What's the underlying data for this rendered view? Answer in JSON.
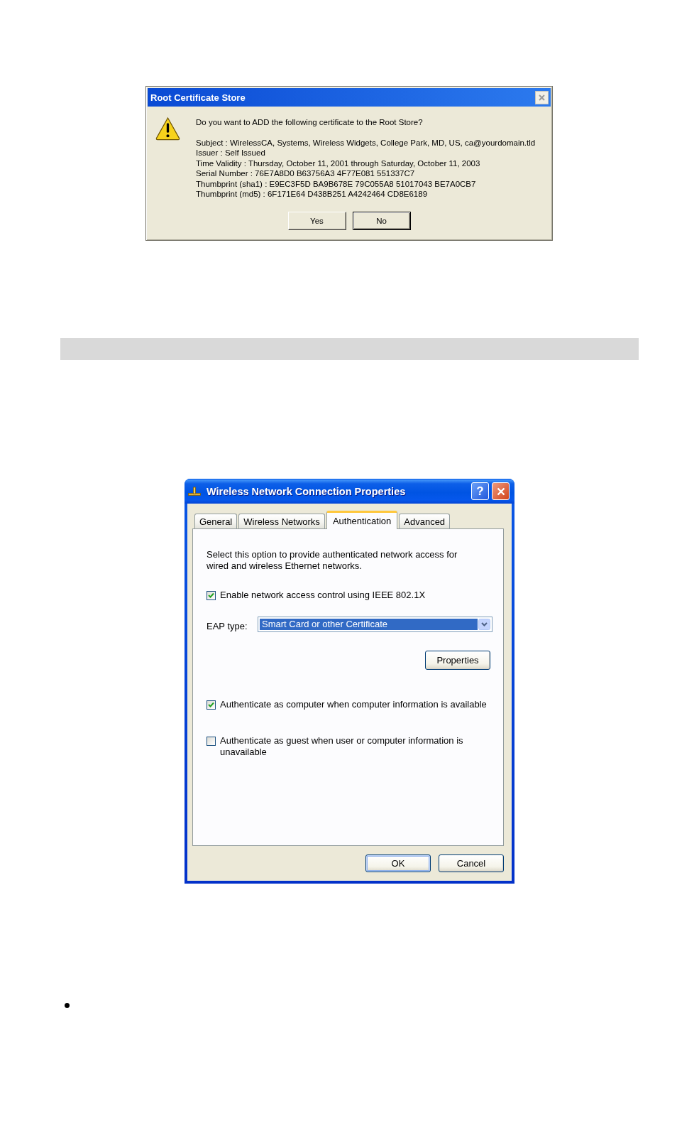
{
  "certificate_dialog": {
    "title": "Root Certificate Store",
    "question": "Do you want to ADD the following certificate to the Root Store?",
    "details": [
      "Subject : WirelessCA, Systems, Wireless Widgets, College Park, MD, US, ca@yourdomain.tld",
      "Issuer : Self Issued",
      "Time Validity : Thursday, October 11, 2001 through Saturday, October 11, 2003",
      "Serial Number : 76E7A8D0 B63756A3 4F77E081 551337C7",
      "Thumbprint (sha1) : E9EC3F5D BA9B678E 79C055A8 51017043 BE7A0CB7",
      "Thumbprint (md5) : 6F171E64 D438B251 A4242464 CD8E6189"
    ],
    "buttons": [
      {
        "label": "Yes",
        "default": false
      },
      {
        "label": "No",
        "default": true
      }
    ]
  },
  "properties_dialog": {
    "title": "Wireless Network Connection Properties",
    "help_button": "?",
    "tabs": [
      {
        "label": "General",
        "selected": false
      },
      {
        "label": "Wireless Networks",
        "selected": false
      },
      {
        "label": "Authentication",
        "selected": true
      },
      {
        "label": "Advanced",
        "selected": false
      }
    ],
    "description": "Select this option to provide authenticated network access for wired and wireless Ethernet networks.",
    "enable_8021x": {
      "label": "Enable network access control using IEEE 802.1X",
      "checked": true
    },
    "eap_type": {
      "label": "EAP type:",
      "value": "Smart Card or other Certificate"
    },
    "properties_button": "Properties",
    "auth_options": [
      {
        "label": "Authenticate as computer when computer information is available",
        "checked": true
      },
      {
        "label": "Authenticate as guest when user or computer information is unavailable",
        "checked": false
      }
    ],
    "buttons": [
      {
        "label": "OK",
        "default": true
      },
      {
        "label": "Cancel",
        "default": false
      }
    ]
  }
}
